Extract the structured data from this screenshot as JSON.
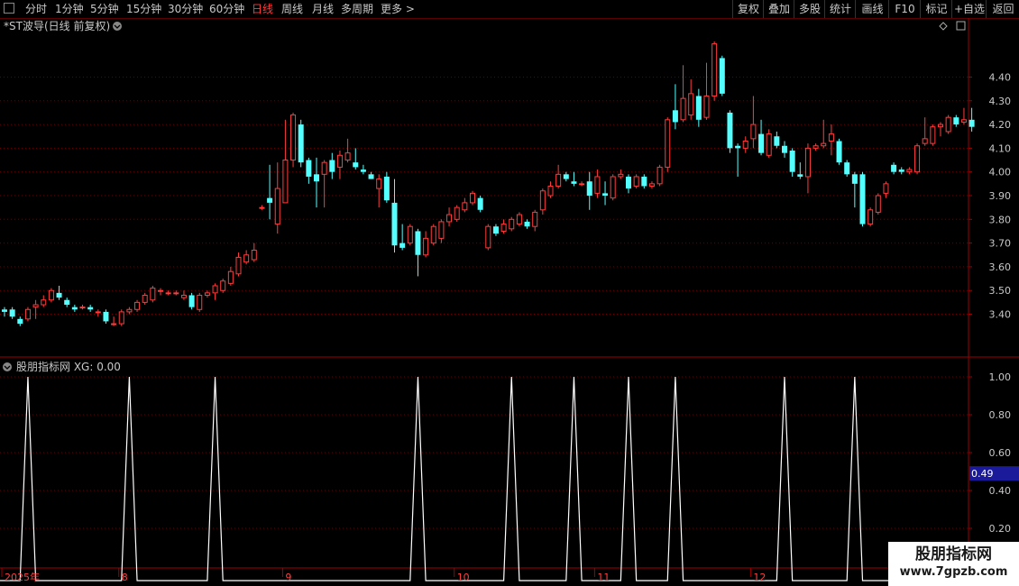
{
  "toolbar": {
    "periods": [
      "分时",
      "1分钟",
      "5分钟",
      "15分钟",
      "30分钟",
      "60分钟",
      "日线",
      "周线",
      "月线",
      "多周期",
      "更多 >"
    ],
    "active_period": "日线",
    "buttons": [
      "复权",
      "叠加",
      "多股",
      "统计",
      "画线",
      "F10",
      "标记",
      "+自选",
      "返回"
    ]
  },
  "main_chart": {
    "title": "*ST波导(日线 前复权)",
    "y_ticks": [
      "4.40",
      "4.30",
      "4.20",
      "4.10",
      "4.00",
      "3.90",
      "3.80",
      "3.70",
      "3.60",
      "3.50",
      "3.40"
    ],
    "colors": {
      "up": "#ff3c3c",
      "down": "#54ffff",
      "grid": "#6a0000",
      "axis": "#a00000"
    }
  },
  "indicator": {
    "title": "股朋指标网 XG: 0.00",
    "y_ticks": [
      "1.00",
      "0.80",
      "0.60",
      "0.40",
      "0.20"
    ],
    "current_value": "0.49",
    "colors": {
      "line": "#ffffff",
      "marker_bg": "#1a1a9a"
    }
  },
  "x_axis": {
    "labels": [
      "2025年",
      "8",
      "9",
      "10",
      "11",
      "12"
    ]
  },
  "watermark": {
    "title": "股朋指标网",
    "url": "www.7gpzb.com"
  },
  "chart_data": [
    {
      "type": "candlestick",
      "title": "*ST波导(日线 前复权)",
      "ylim": [
        3.25,
        4.55
      ],
      "y_ticks": [
        4.4,
        4.3,
        4.2,
        4.1,
        4.0,
        3.9,
        3.8,
        3.7,
        3.6,
        3.5,
        3.4
      ],
      "grid": true,
      "candles": [
        {
          "o": 3.42,
          "h": 3.43,
          "l": 3.39,
          "c": 3.41
        },
        {
          "o": 3.42,
          "h": 3.43,
          "l": 3.38,
          "c": 3.39
        },
        {
          "o": 3.38,
          "h": 3.39,
          "l": 3.35,
          "c": 3.36
        },
        {
          "o": 3.38,
          "h": 3.43,
          "l": 3.37,
          "c": 3.42
        },
        {
          "o": 3.43,
          "h": 3.46,
          "l": 3.38,
          "c": 3.44
        },
        {
          "o": 3.44,
          "h": 3.48,
          "l": 3.43,
          "c": 3.46
        },
        {
          "o": 3.46,
          "h": 3.51,
          "l": 3.45,
          "c": 3.5
        },
        {
          "o": 3.49,
          "h": 3.52,
          "l": 3.46,
          "c": 3.47
        },
        {
          "o": 3.46,
          "h": 3.47,
          "l": 3.43,
          "c": 3.44
        },
        {
          "o": 3.43,
          "h": 3.44,
          "l": 3.41,
          "c": 3.42
        },
        {
          "o": 3.43,
          "h": 3.44,
          "l": 3.42,
          "c": 3.43
        },
        {
          "o": 3.43,
          "h": 3.44,
          "l": 3.41,
          "c": 3.42
        },
        {
          "o": 3.41,
          "h": 3.42,
          "l": 3.39,
          "c": 3.41
        },
        {
          "o": 3.41,
          "h": 3.42,
          "l": 3.36,
          "c": 3.37
        },
        {
          "o": 3.36,
          "h": 3.39,
          "l": 3.35,
          "c": 3.36
        },
        {
          "o": 3.36,
          "h": 3.42,
          "l": 3.35,
          "c": 3.41
        },
        {
          "o": 3.41,
          "h": 3.43,
          "l": 3.4,
          "c": 3.42
        },
        {
          "o": 3.42,
          "h": 3.46,
          "l": 3.41,
          "c": 3.45
        },
        {
          "o": 3.45,
          "h": 3.49,
          "l": 3.44,
          "c": 3.48
        },
        {
          "o": 3.46,
          "h": 3.52,
          "l": 3.45,
          "c": 3.51
        },
        {
          "o": 3.5,
          "h": 3.51,
          "l": 3.48,
          "c": 3.5
        },
        {
          "o": 3.49,
          "h": 3.5,
          "l": 3.48,
          "c": 3.49
        },
        {
          "o": 3.49,
          "h": 3.5,
          "l": 3.48,
          "c": 3.49
        },
        {
          "o": 3.47,
          "h": 3.5,
          "l": 3.46,
          "c": 3.48
        },
        {
          "o": 3.48,
          "h": 3.49,
          "l": 3.42,
          "c": 3.43
        },
        {
          "o": 3.42,
          "h": 3.49,
          "l": 3.41,
          "c": 3.48
        },
        {
          "o": 3.48,
          "h": 3.5,
          "l": 3.47,
          "c": 3.49
        },
        {
          "o": 3.49,
          "h": 3.53,
          "l": 3.46,
          "c": 3.52
        },
        {
          "o": 3.5,
          "h": 3.55,
          "l": 3.49,
          "c": 3.54
        },
        {
          "o": 3.53,
          "h": 3.6,
          "l": 3.52,
          "c": 3.58
        },
        {
          "o": 3.57,
          "h": 3.66,
          "l": 3.56,
          "c": 3.64
        },
        {
          "o": 3.62,
          "h": 3.67,
          "l": 3.61,
          "c": 3.65
        },
        {
          "o": 3.63,
          "h": 3.7,
          "l": 3.62,
          "c": 3.67
        },
        {
          "o": 3.85,
          "h": 3.86,
          "l": 3.84,
          "c": 3.85
        },
        {
          "o": 3.89,
          "h": 4.03,
          "l": 3.8,
          "c": 3.87
        },
        {
          "o": 3.78,
          "h": 4.04,
          "l": 3.74,
          "c": 3.93
        },
        {
          "o": 3.87,
          "h": 4.22,
          "l": 3.87,
          "c": 4.05
        },
        {
          "o": 4.05,
          "h": 4.25,
          "l": 4.02,
          "c": 4.24
        },
        {
          "o": 4.2,
          "h": 4.22,
          "l": 4.02,
          "c": 4.04
        },
        {
          "o": 4.05,
          "h": 4.06,
          "l": 3.95,
          "c": 3.98
        },
        {
          "o": 3.99,
          "h": 4.06,
          "l": 3.85,
          "c": 3.96
        },
        {
          "o": 3.99,
          "h": 4.05,
          "l": 3.85,
          "c": 4.04
        },
        {
          "o": 4.05,
          "h": 4.08,
          "l": 3.97,
          "c": 4.0
        },
        {
          "o": 4.02,
          "h": 4.09,
          "l": 3.97,
          "c": 4.07
        },
        {
          "o": 4.05,
          "h": 4.14,
          "l": 4.04,
          "c": 4.08
        },
        {
          "o": 4.04,
          "h": 4.1,
          "l": 4.01,
          "c": 4.02
        },
        {
          "o": 4.01,
          "h": 4.03,
          "l": 3.99,
          "c": 4.0
        },
        {
          "o": 3.99,
          "h": 4.0,
          "l": 3.97,
          "c": 3.97
        },
        {
          "o": 3.93,
          "h": 3.99,
          "l": 3.85,
          "c": 3.97
        },
        {
          "o": 3.98,
          "h": 4.0,
          "l": 3.87,
          "c": 3.88
        },
        {
          "o": 3.87,
          "h": 3.97,
          "l": 3.66,
          "c": 3.69
        },
        {
          "o": 3.7,
          "h": 3.78,
          "l": 3.67,
          "c": 3.68
        },
        {
          "o": 3.7,
          "h": 3.78,
          "l": 3.69,
          "c": 3.77
        },
        {
          "o": 3.75,
          "h": 3.76,
          "l": 3.56,
          "c": 3.65
        },
        {
          "o": 3.65,
          "h": 3.75,
          "l": 3.64,
          "c": 3.72
        },
        {
          "o": 3.7,
          "h": 3.78,
          "l": 3.69,
          "c": 3.77
        },
        {
          "o": 3.72,
          "h": 3.8,
          "l": 3.7,
          "c": 3.79
        },
        {
          "o": 3.79,
          "h": 3.85,
          "l": 3.77,
          "c": 3.82
        },
        {
          "o": 3.8,
          "h": 3.86,
          "l": 3.79,
          "c": 3.85
        },
        {
          "o": 3.84,
          "h": 3.89,
          "l": 3.83,
          "c": 3.87
        },
        {
          "o": 3.87,
          "h": 3.92,
          "l": 3.86,
          "c": 3.91
        },
        {
          "o": 3.89,
          "h": 3.9,
          "l": 3.83,
          "c": 3.84
        },
        {
          "o": 3.68,
          "h": 3.78,
          "l": 3.67,
          "c": 3.77
        },
        {
          "o": 3.77,
          "h": 3.78,
          "l": 3.73,
          "c": 3.74
        },
        {
          "o": 3.75,
          "h": 3.8,
          "l": 3.74,
          "c": 3.78
        },
        {
          "o": 3.76,
          "h": 3.81,
          "l": 3.75,
          "c": 3.8
        },
        {
          "o": 3.78,
          "h": 3.83,
          "l": 3.77,
          "c": 3.82
        },
        {
          "o": 3.79,
          "h": 3.8,
          "l": 3.76,
          "c": 3.77
        },
        {
          "o": 3.77,
          "h": 3.84,
          "l": 3.75,
          "c": 3.83
        },
        {
          "o": 3.84,
          "h": 3.93,
          "l": 3.82,
          "c": 3.92
        },
        {
          "o": 3.9,
          "h": 3.96,
          "l": 3.89,
          "c": 3.94
        },
        {
          "o": 3.94,
          "h": 4.03,
          "l": 3.93,
          "c": 3.99
        },
        {
          "o": 3.99,
          "h": 4.0,
          "l": 3.96,
          "c": 3.97
        },
        {
          "o": 3.96,
          "h": 4.0,
          "l": 3.94,
          "c": 3.95
        },
        {
          "o": 3.95,
          "h": 3.96,
          "l": 3.94,
          "c": 3.95
        },
        {
          "o": 3.96,
          "h": 4.0,
          "l": 3.84,
          "c": 3.9
        },
        {
          "o": 3.91,
          "h": 4.01,
          "l": 3.89,
          "c": 3.98
        },
        {
          "o": 3.91,
          "h": 3.96,
          "l": 3.86,
          "c": 3.9
        },
        {
          "o": 3.89,
          "h": 3.99,
          "l": 3.88,
          "c": 3.98
        },
        {
          "o": 3.98,
          "h": 4.01,
          "l": 3.97,
          "c": 3.99
        },
        {
          "o": 3.98,
          "h": 3.99,
          "l": 3.91,
          "c": 3.93
        },
        {
          "o": 3.94,
          "h": 3.99,
          "l": 3.93,
          "c": 3.98
        },
        {
          "o": 3.98,
          "h": 3.99,
          "l": 3.93,
          "c": 3.94
        },
        {
          "o": 3.94,
          "h": 3.96,
          "l": 3.93,
          "c": 3.95
        },
        {
          "o": 3.95,
          "h": 4.03,
          "l": 3.94,
          "c": 4.02
        },
        {
          "o": 4.02,
          "h": 4.23,
          "l": 4.0,
          "c": 4.22
        },
        {
          "o": 4.26,
          "h": 4.37,
          "l": 4.18,
          "c": 4.21
        },
        {
          "o": 4.22,
          "h": 4.45,
          "l": 4.21,
          "c": 4.31
        },
        {
          "o": 4.24,
          "h": 4.39,
          "l": 4.22,
          "c": 4.33
        },
        {
          "o": 4.32,
          "h": 4.35,
          "l": 4.19,
          "c": 4.22
        },
        {
          "o": 4.23,
          "h": 4.46,
          "l": 4.22,
          "c": 4.32
        },
        {
          "o": 4.32,
          "h": 4.55,
          "l": 4.3,
          "c": 4.54
        },
        {
          "o": 4.48,
          "h": 4.49,
          "l": 4.32,
          "c": 4.33
        },
        {
          "o": 4.25,
          "h": 4.26,
          "l": 4.08,
          "c": 4.1
        },
        {
          "o": 4.11,
          "h": 4.12,
          "l": 3.98,
          "c": 4.1
        },
        {
          "o": 4.1,
          "h": 4.15,
          "l": 4.08,
          "c": 4.13
        },
        {
          "o": 4.14,
          "h": 4.32,
          "l": 4.1,
          "c": 4.2
        },
        {
          "o": 4.16,
          "h": 4.22,
          "l": 4.07,
          "c": 4.08
        },
        {
          "o": 4.07,
          "h": 4.18,
          "l": 4.06,
          "c": 4.16
        },
        {
          "o": 4.15,
          "h": 4.17,
          "l": 4.1,
          "c": 4.11
        },
        {
          "o": 4.11,
          "h": 4.13,
          "l": 4.06,
          "c": 4.08
        },
        {
          "o": 4.09,
          "h": 4.1,
          "l": 3.98,
          "c": 4.0
        },
        {
          "o": 3.99,
          "h": 4.04,
          "l": 3.97,
          "c": 3.98
        },
        {
          "o": 3.98,
          "h": 4.12,
          "l": 3.91,
          "c": 4.1
        },
        {
          "o": 4.1,
          "h": 4.12,
          "l": 4.09,
          "c": 4.11
        },
        {
          "o": 4.11,
          "h": 4.22,
          "l": 4.1,
          "c": 4.12
        },
        {
          "o": 4.13,
          "h": 4.2,
          "l": 4.07,
          "c": 4.16
        },
        {
          "o": 4.13,
          "h": 4.14,
          "l": 4.03,
          "c": 4.04
        },
        {
          "o": 4.04,
          "h": 4.05,
          "l": 3.98,
          "c": 3.99
        },
        {
          "o": 3.99,
          "h": 4.0,
          "l": 3.85,
          "c": 3.95
        },
        {
          "o": 3.99,
          "h": 4.0,
          "l": 3.77,
          "c": 3.78
        },
        {
          "o": 3.78,
          "h": 3.85,
          "l": 3.77,
          "c": 3.84
        },
        {
          "o": 3.83,
          "h": 3.91,
          "l": 3.82,
          "c": 3.9
        },
        {
          "o": 3.91,
          "h": 3.96,
          "l": 3.89,
          "c": 3.95
        },
        {
          "o": 4.03,
          "h": 4.04,
          "l": 3.99,
          "c": 4.0
        },
        {
          "o": 4.01,
          "h": 4.02,
          "l": 3.99,
          "c": 4.0
        },
        {
          "o": 4.0,
          "h": 4.02,
          "l": 3.99,
          "c": 4.01
        },
        {
          "o": 4.0,
          "h": 4.12,
          "l": 3.99,
          "c": 4.11
        },
        {
          "o": 4.12,
          "h": 4.23,
          "l": 4.11,
          "c": 4.14
        },
        {
          "o": 4.12,
          "h": 4.2,
          "l": 4.11,
          "c": 4.19
        },
        {
          "o": 4.19,
          "h": 4.21,
          "l": 4.15,
          "c": 4.2
        },
        {
          "o": 4.17,
          "h": 4.24,
          "l": 4.16,
          "c": 4.23
        },
        {
          "o": 4.23,
          "h": 4.24,
          "l": 4.19,
          "c": 4.2
        },
        {
          "o": 4.21,
          "h": 4.27,
          "l": 4.2,
          "c": 4.22
        },
        {
          "o": 4.22,
          "h": 4.27,
          "l": 4.17,
          "c": 4.19
        }
      ]
    },
    {
      "type": "line",
      "title": "股朋指标网 XG: 0.00",
      "ylim": [
        0.0,
        1.0
      ],
      "y_ticks": [
        1.0,
        0.8,
        0.6,
        0.4,
        0.2
      ],
      "series": [
        {
          "name": "XG",
          "peak_indices": [
            3,
            16,
            27,
            53,
            65,
            73,
            80,
            86,
            100,
            109
          ],
          "peak_value": 1.0
        }
      ]
    }
  ]
}
